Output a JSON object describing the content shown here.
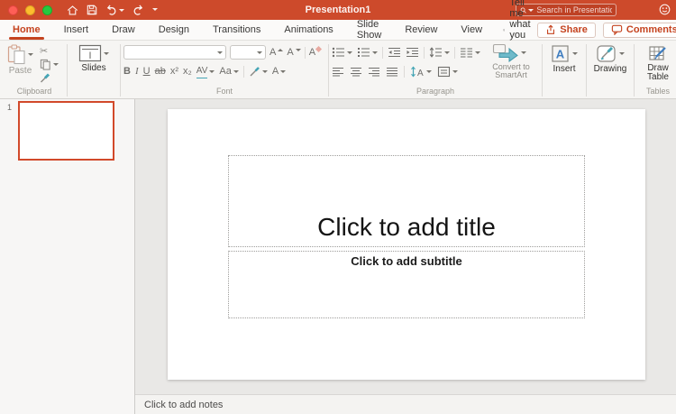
{
  "titlebar": {
    "title": "Presentation1",
    "search": {
      "placeholder": "Search in Presentation"
    }
  },
  "tabs": {
    "items": [
      {
        "label": "Home",
        "active": true
      },
      {
        "label": "Insert"
      },
      {
        "label": "Draw"
      },
      {
        "label": "Design"
      },
      {
        "label": "Transitions"
      },
      {
        "label": "Animations"
      },
      {
        "label": "Slide Show"
      },
      {
        "label": "Review"
      },
      {
        "label": "View"
      }
    ],
    "tell_me": "Tell me what you want to do",
    "share_label": "Share",
    "comments_label": "Comments"
  },
  "ribbon": {
    "clipboard": {
      "paste_label": "Paste",
      "group_label": "Clipboard"
    },
    "slides": {
      "label": "Slides"
    },
    "font": {
      "group_label": "Font",
      "bold": "B",
      "italic": "I",
      "underline": "U",
      "strikethrough": "ab",
      "superscript": "x²",
      "subscript": "x₂",
      "char_spacing": "AV",
      "change_case": "Aa",
      "grow_font": "A",
      "shrink_font": "A",
      "clear_formatting": "A",
      "font_color": "A"
    },
    "paragraph": {
      "group_label": "Paragraph",
      "convert_smartart_label": "Convert to SmartArt"
    },
    "insert": {
      "label": "Insert"
    },
    "drawing": {
      "label": "Drawing"
    },
    "tables": {
      "button_label": "Draw Table",
      "group_label": "Tables"
    }
  },
  "thumbnails": {
    "slide_number": "1"
  },
  "canvas": {
    "title_placeholder": "Click to add title",
    "subtitle_placeholder": "Click to add subtitle"
  },
  "notes": {
    "placeholder": "Click to add notes"
  },
  "colors": {
    "titlebar_red": "#CD4A2B",
    "accent_red": "#C5431F",
    "accent_blue": "#3E7DC0",
    "accent_teal": "#45A5B5",
    "ribbon_bg": "#F6F5F3",
    "canvas_bg": "#E9E8E6",
    "selected_thumb_border": "#D2492A"
  }
}
